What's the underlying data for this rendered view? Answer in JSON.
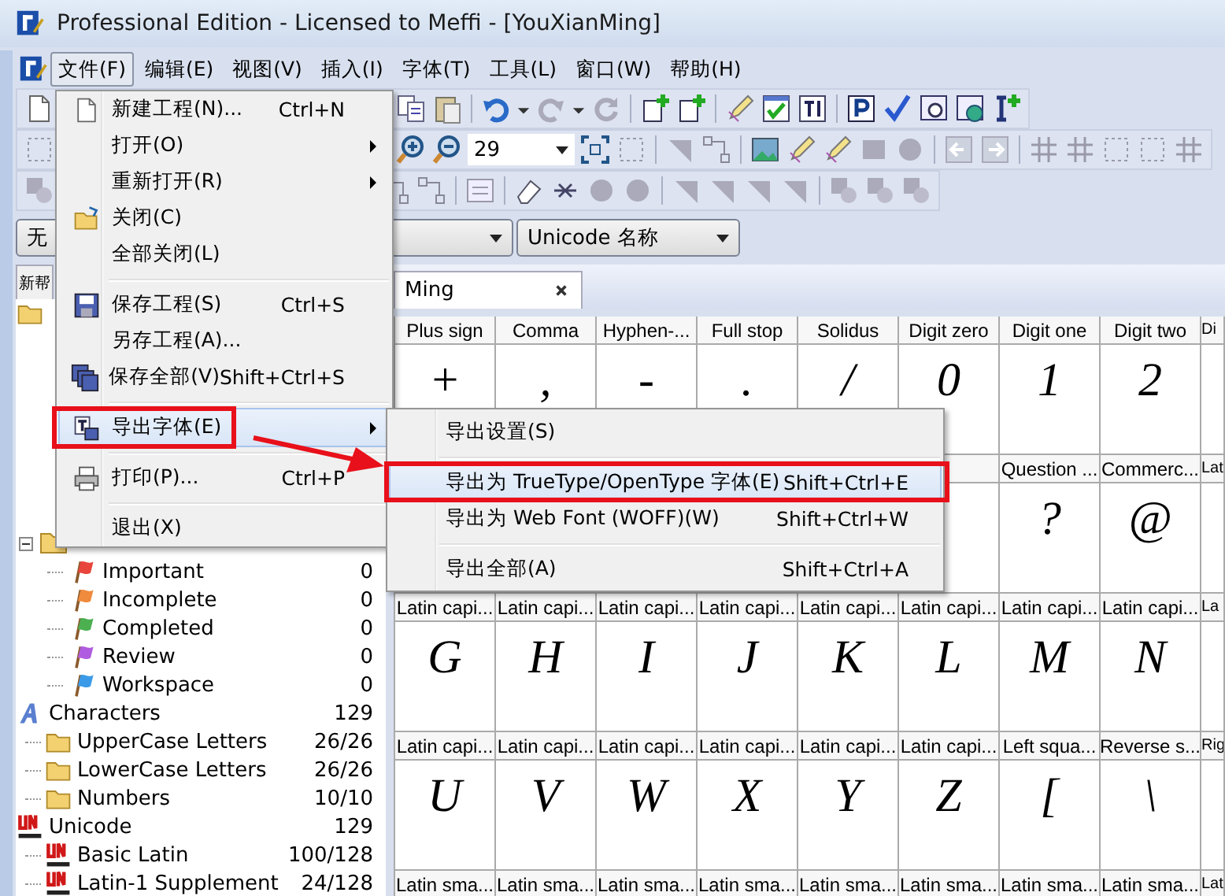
{
  "window": {
    "title": "Professional Edition - Licensed to Meffi - [YouXianMing]"
  },
  "menubar": [
    {
      "label": "文件(F)",
      "selected": true
    },
    {
      "label": "编辑(E)",
      "selected": false
    },
    {
      "label": "视图(V)",
      "selected": false
    },
    {
      "label": "插入(I)",
      "selected": false
    },
    {
      "label": "字体(T)",
      "selected": false
    },
    {
      "label": "工具(L)",
      "selected": false
    },
    {
      "label": "窗口(W)",
      "selected": false
    },
    {
      "label": "帮助(H)",
      "selected": false
    }
  ],
  "toolbar": {
    "zoom": "29"
  },
  "combos": [
    {
      "value": "无"
    },
    {
      "value": "Unicode 名称"
    }
  ],
  "sidebar": {
    "tab": "新帮",
    "tree": [
      {
        "kind": "folder",
        "expanded": true,
        "children": [
          {
            "kind": "flag",
            "label": "Important",
            "count": "0",
            "color": "#e8453c"
          },
          {
            "kind": "flag",
            "label": "Incomplete",
            "count": "0",
            "color": "#f08a3c"
          },
          {
            "kind": "flag",
            "label": "Completed",
            "count": "0",
            "color": "#4caf50"
          },
          {
            "kind": "flag",
            "label": "Review",
            "count": "0",
            "color": "#b05ce0"
          },
          {
            "kind": "flag",
            "label": "Workspace",
            "count": "0",
            "color": "#3b9be8"
          }
        ]
      },
      {
        "kind": "characters",
        "label": "Characters",
        "count": "129",
        "children": [
          {
            "kind": "folder",
            "label": "UpperCase Letters",
            "count": "26/26"
          },
          {
            "kind": "folder",
            "label": "LowerCase Letters",
            "count": "26/26"
          },
          {
            "kind": "folder",
            "label": "Numbers",
            "count": "10/10"
          }
        ]
      },
      {
        "kind": "unicode",
        "label": "Unicode",
        "count": "129",
        "children": [
          {
            "kind": "unicode",
            "label": "Basic Latin",
            "count": "100/128"
          },
          {
            "kind": "unicode",
            "label": "Latin-1 Supplement",
            "count": "24/128"
          }
        ]
      }
    ]
  },
  "document_tab": {
    "label": "Ming"
  },
  "grid": {
    "rows": [
      {
        "cells": [
          {
            "label": "Plus sign",
            "glyph": "+"
          },
          {
            "label": "Comma",
            "glyph": ","
          },
          {
            "label": "Hyphen-...",
            "glyph": "-"
          },
          {
            "label": "Full stop",
            "glyph": "."
          },
          {
            "label": "Solidus",
            "glyph": "/"
          },
          {
            "label": "Digit zero",
            "glyph": "0"
          },
          {
            "label": "Digit one",
            "glyph": "1"
          },
          {
            "label": "Digit two",
            "glyph": "2"
          },
          {
            "label": "Di"
          }
        ]
      },
      {
        "cells": [
          {},
          {},
          {},
          {},
          {},
          {},
          {
            "label": "Question ...",
            "glyph": "?"
          },
          {
            "label": "Commerc...",
            "glyph": "@"
          },
          {
            "label": "Lat"
          }
        ]
      },
      {
        "cells": [
          {
            "label": "Latin capi...",
            "glyph": "G"
          },
          {
            "label": "Latin capi...",
            "glyph": "H"
          },
          {
            "label": "Latin capi...",
            "glyph": "I"
          },
          {
            "label": "Latin capi...",
            "glyph": "J"
          },
          {
            "label": "Latin capi...",
            "glyph": "K"
          },
          {
            "label": "Latin capi...",
            "glyph": "L"
          },
          {
            "label": "Latin capi...",
            "glyph": "M"
          },
          {
            "label": "Latin capi...",
            "glyph": "N"
          },
          {
            "label": "La"
          }
        ]
      },
      {
        "cells": [
          {
            "label": "Latin capi...",
            "glyph": "U"
          },
          {
            "label": "Latin capi...",
            "glyph": "V"
          },
          {
            "label": "Latin capi...",
            "glyph": "W"
          },
          {
            "label": "Latin capi...",
            "glyph": "X"
          },
          {
            "label": "Latin capi...",
            "glyph": "Y"
          },
          {
            "label": "Latin capi...",
            "glyph": "Z"
          },
          {
            "label": "Left squa...",
            "glyph": "["
          },
          {
            "label": "Reverse s...",
            "glyph": "\\"
          },
          {
            "label": "Rig"
          }
        ]
      },
      {
        "cells": [
          {
            "label": "Latin sma..."
          },
          {
            "label": "Latin sma..."
          },
          {
            "label": "Latin sma..."
          },
          {
            "label": "Latin sma..."
          },
          {
            "label": "Latin sma..."
          },
          {
            "label": "Latin sma..."
          },
          {
            "label": "Latin sma..."
          },
          {
            "label": "Latin sma..."
          },
          {
            "label": "Lat"
          }
        ]
      }
    ]
  },
  "file_menu": [
    {
      "kind": "item",
      "label": "新建工程(N)...",
      "shortcut": "Ctrl+N",
      "submenu": false,
      "selected": false,
      "annotated": false
    },
    {
      "kind": "item",
      "label": "打开(O)",
      "submenu": true,
      "selected": false,
      "annotated": false
    },
    {
      "kind": "item",
      "label": "重新打开(R)",
      "submenu": true,
      "selected": false,
      "annotated": false
    },
    {
      "kind": "item",
      "label": "关闭(C)",
      "submenu": false,
      "selected": false,
      "annotated": false
    },
    {
      "kind": "item",
      "label": "全部关闭(L)",
      "submenu": false,
      "selected": false,
      "annotated": false
    },
    {
      "kind": "separator"
    },
    {
      "kind": "item",
      "label": "保存工程(S)",
      "shortcut": "Ctrl+S",
      "submenu": false,
      "selected": false,
      "annotated": false
    },
    {
      "kind": "item",
      "label": "另存工程(A)...",
      "submenu": false,
      "selected": false,
      "annotated": false
    },
    {
      "kind": "item",
      "label": "保存全部(V)",
      "shortcut": "Shift+Ctrl+S",
      "submenu": false,
      "selected": false,
      "annotated": false
    },
    {
      "kind": "separator"
    },
    {
      "kind": "item",
      "label": "导出字体(E)",
      "submenu": true,
      "selected": true,
      "annotated": true
    },
    {
      "kind": "separator"
    },
    {
      "kind": "item",
      "label": "打印(P)...",
      "shortcut": "Ctrl+P",
      "submenu": false,
      "selected": false,
      "annotated": false
    },
    {
      "kind": "separator"
    },
    {
      "kind": "item",
      "label": "退出(X)",
      "submenu": false,
      "selected": false,
      "annotated": false
    }
  ],
  "export_submenu": [
    {
      "kind": "item",
      "label": "导出设置(S)",
      "selected": false,
      "annotated": false
    },
    {
      "kind": "separator"
    },
    {
      "kind": "item",
      "label": "导出为 TrueType/OpenType 字体(E)",
      "shortcut": "Shift+Ctrl+E",
      "selected": true,
      "annotated": true
    },
    {
      "kind": "item",
      "label": "导出为 Web Font (WOFF)(W)",
      "shortcut": "Shift+Ctrl+W",
      "selected": false,
      "annotated": false
    },
    {
      "kind": "separator"
    },
    {
      "kind": "item",
      "label": "导出全部(A)",
      "shortcut": "Shift+Ctrl+A",
      "selected": false,
      "annotated": false
    }
  ],
  "annotation_arrow": true
}
